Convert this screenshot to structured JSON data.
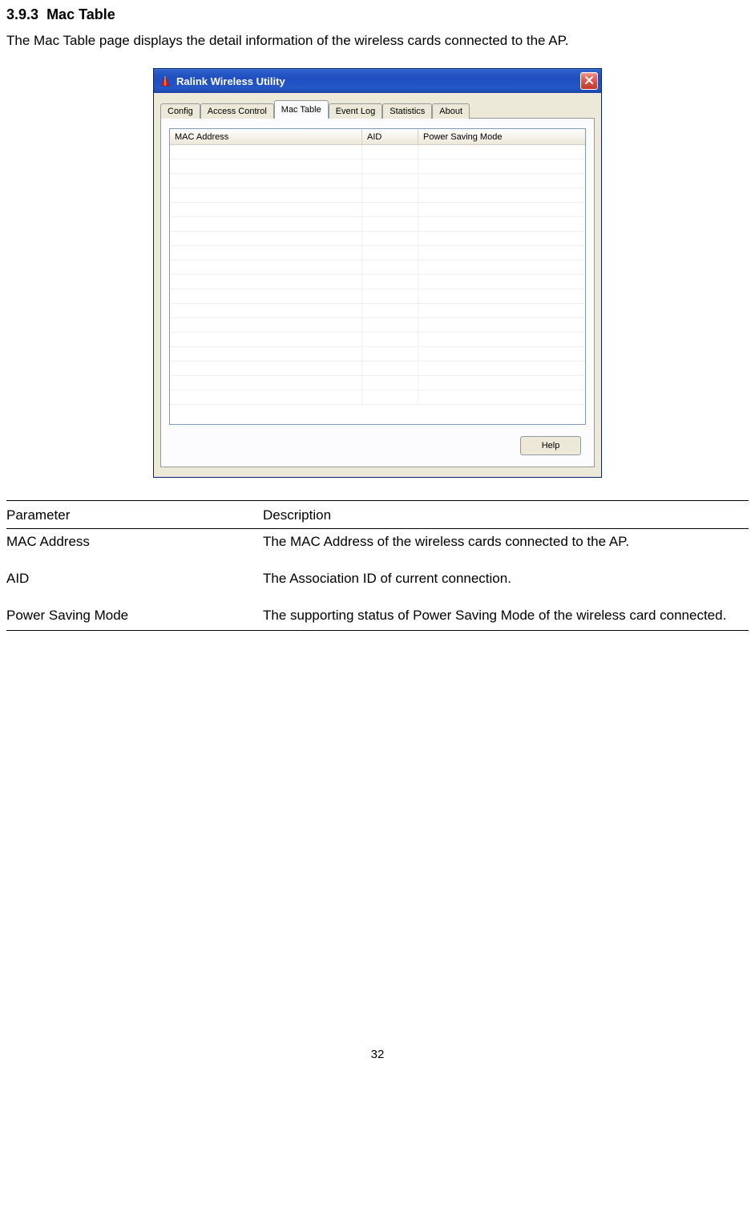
{
  "section": {
    "number": "3.9.3",
    "title": "Mac Table",
    "intro": "The Mac Table page displays the detail information of the wireless cards connected to the AP."
  },
  "dialog": {
    "title": "Ralink Wireless Utility",
    "close_label": "X",
    "tabs": [
      {
        "label": "Config"
      },
      {
        "label": "Access Control"
      },
      {
        "label": "Mac Table"
      },
      {
        "label": "Event Log"
      },
      {
        "label": "Statistics"
      },
      {
        "label": "About"
      }
    ],
    "active_tab_index": 2,
    "columns": {
      "mac": "MAC Address",
      "aid": "AID",
      "psm": "Power Saving Mode"
    },
    "rows": [],
    "help_button": "Help"
  },
  "desc": {
    "header": {
      "param": "Parameter",
      "desc": "Description"
    },
    "r1": {
      "param": "MAC Address",
      "desc": "The MAC Address of the wireless cards connected to the AP."
    },
    "r2": {
      "param": "AID",
      "desc": "The Association ID of current connection."
    },
    "r3": {
      "param": "Power Saving Mode",
      "desc": "The supporting status of Power Saving Mode of the wireless card connected."
    }
  },
  "page_number": "32"
}
